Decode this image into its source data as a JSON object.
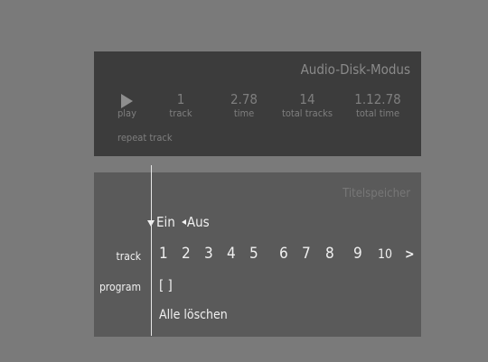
{
  "status": {
    "title": "Audio-Disk-Modus",
    "play": {
      "icon": "play-icon",
      "label": "play"
    },
    "track": {
      "value": "1",
      "label": "track"
    },
    "time": {
      "value": "2.78",
      "label": "time"
    },
    "total_tracks": {
      "value": "14",
      "label": "total tracks"
    },
    "total_time": {
      "value": "1.12.78",
      "label": "total time"
    },
    "repeat": "repeat track"
  },
  "memory": {
    "title": "Titelspeicher",
    "on_label": "Ein",
    "off_label": "Aus",
    "track_label": "track",
    "program_label": "program",
    "tracks": [
      "1",
      "2",
      "3",
      "4",
      "5",
      "6",
      "7",
      "8",
      "9",
      "10"
    ],
    "more": ">",
    "program_value": "[ ]",
    "clear_all": "Alle löschen"
  },
  "colors": {
    "background": "#7a7a7a",
    "status_panel": "#3c3c3c",
    "memory_panel": "#5a5a5a",
    "text_active": "#f0f0f0",
    "text_dim": "#7e7e7e"
  }
}
